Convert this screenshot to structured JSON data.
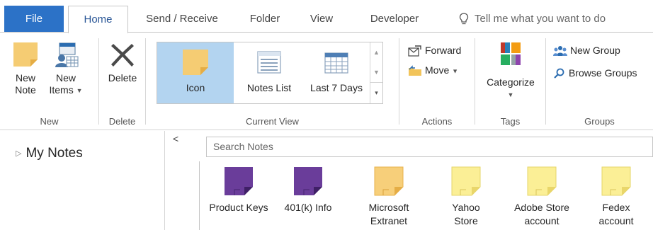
{
  "tabs": {
    "file": "File",
    "home": "Home",
    "send_receive": "Send / Receive",
    "folder": "Folder",
    "view": "View",
    "developer": "Developer",
    "tell_me": "Tell me what you want to do"
  },
  "ribbon": {
    "new_group": {
      "label": "New",
      "new_note_1": "New",
      "new_note_2": "Note",
      "new_items_1": "New",
      "new_items_2": "Items"
    },
    "delete_group": {
      "label": "Delete",
      "delete": "Delete"
    },
    "current_view": {
      "label": "Current View",
      "icon": "Icon",
      "notes_list": "Notes List",
      "last7": "Last 7 Days"
    },
    "actions": {
      "label": "Actions",
      "forward": "Forward",
      "move": "Move"
    },
    "tags": {
      "label": "Tags",
      "categorize": "Categorize"
    },
    "groups": {
      "label": "Groups",
      "new_group": "New Group",
      "browse_groups": "Browse Groups"
    }
  },
  "nav": {
    "my_notes": "My Notes",
    "collapse": "<"
  },
  "search": {
    "placeholder": "Search Notes"
  },
  "notes": [
    {
      "line1": "Product Keys",
      "line2": "",
      "color": "purple"
    },
    {
      "line1": "401(k) Info",
      "line2": "",
      "color": "purple"
    },
    {
      "line1": "Microsoft",
      "line2": "Extranet",
      "color": "orange"
    },
    {
      "line1": "Yahoo",
      "line2": "Store",
      "color": "yellow"
    },
    {
      "line1": "Adobe Store",
      "line2": "account",
      "color": "yellow"
    },
    {
      "line1": "Fedex",
      "line2": "account",
      "color": "yellow"
    }
  ],
  "colors": {
    "accent": "#2c72c7",
    "selected_view": "#b3d4f0",
    "note_purple": "#6a3d9a",
    "note_orange": "#f7cf7a",
    "note_yellow": "#fbef96"
  }
}
